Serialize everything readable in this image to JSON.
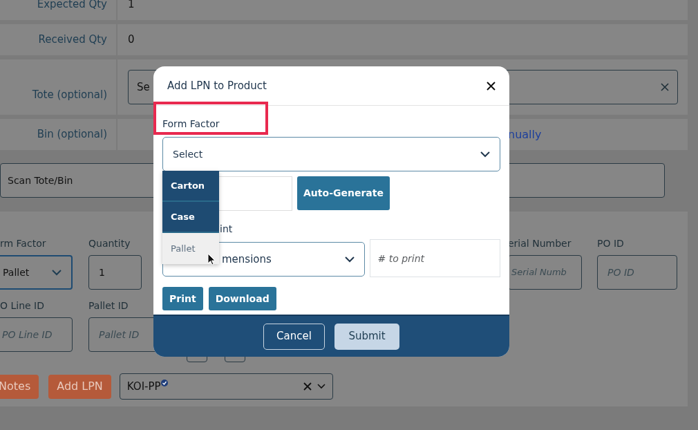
{
  "details": [
    {
      "label": "Expected Qty",
      "value": "1"
    },
    {
      "label": "Received Qty",
      "value": "0"
    }
  ],
  "tote": {
    "label": "Tote (optional)",
    "value": "Se"
  },
  "bin": {
    "label": "Bin (optional)",
    "link": "nually"
  },
  "scan": {
    "placeholder": "Scan Tote/Bin"
  },
  "field_rows": [
    [
      {
        "label": "rm Factor",
        "kind": "select",
        "value": "Pallet"
      },
      {
        "label": "Quantity",
        "kind": "input",
        "value": "1"
      },
      {
        "label": "erial Number",
        "kind": "input",
        "placeholder": "Serial Numb"
      },
      {
        "label": "PO ID",
        "kind": "input",
        "placeholder": "PO ID"
      }
    ],
    [
      {
        "label": "O Line ID",
        "kind": "input",
        "placeholder": "PO Line ID"
      },
      {
        "label": "Pallet ID",
        "kind": "input",
        "placeholder": "Pallet ID"
      }
    ]
  ],
  "actions": [
    {
      "label": "Notes"
    },
    {
      "label": "Add LPN"
    }
  ],
  "product_select": {
    "value": "KOI-PP",
    "verified": true
  },
  "modal": {
    "title": "Add LPN to Product",
    "form_factor": {
      "label": "Form Factor",
      "highlighted": true,
      "value": "Select"
    },
    "auto_generate": "Auto-Generate",
    "print_label": "int",
    "label_select": {
      "value": "mensions"
    },
    "print_count": {
      "placeholder": "# to print"
    },
    "buttons": [
      {
        "label": "Print"
      },
      {
        "label": "Download"
      }
    ],
    "footer": [
      {
        "label": "Cancel",
        "kind": "outline"
      },
      {
        "label": "Submit",
        "kind": "primary"
      }
    ]
  },
  "dropdown": [
    {
      "label": "Carton",
      "highlighted": true
    },
    {
      "label": "Case",
      "highlighted": true
    },
    {
      "label": "Pallet",
      "highlighted": false
    }
  ]
}
